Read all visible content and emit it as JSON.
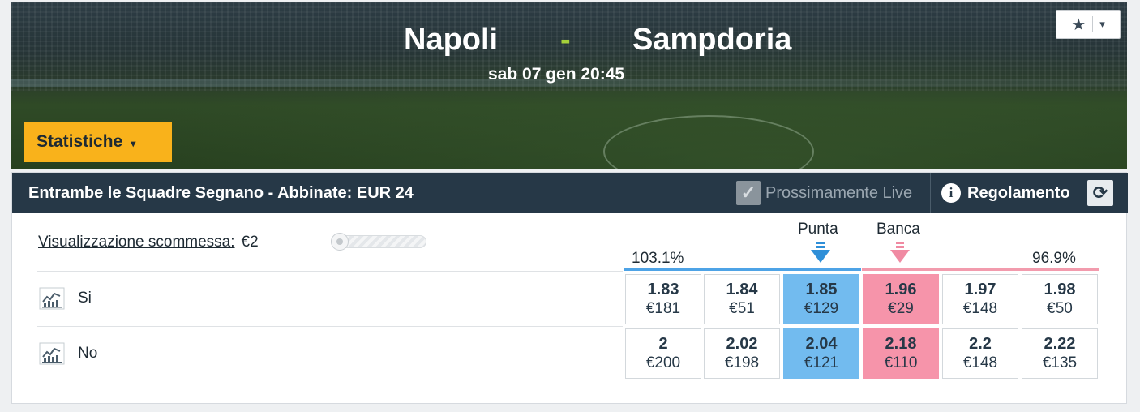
{
  "event": {
    "home_team": "Napoli",
    "separator": "-",
    "away_team": "Sampdoria",
    "datetime": "sab 07 gen 20:45"
  },
  "favourite": {
    "star": "★",
    "chevron": "▾"
  },
  "stats_button": {
    "label": "Statistiche",
    "caret": "▾"
  },
  "market": {
    "title": "Entrambe le Squadre Segnano - Abbinate: EUR 24",
    "live_label": "Prossimamente Live",
    "live_check": "✓",
    "rules_label": "Regolamento",
    "info_glyph": "i",
    "refresh_glyph": "⟳"
  },
  "stake": {
    "label": "Visualizzazione scommessa:",
    "value": "€2"
  },
  "columns": {
    "back_label": "Punta",
    "lay_label": "Banca",
    "back_pct": "103.1%",
    "lay_pct": "96.9%"
  },
  "colors": {
    "back_best": "#72bbef",
    "lay_best": "#f694aa",
    "header_bar": "#263847",
    "accent": "#f9b21b"
  },
  "runners": [
    {
      "name": "Si",
      "odds": [
        {
          "price": "1.83",
          "size": "€181"
        },
        {
          "price": "1.84",
          "size": "€51"
        },
        {
          "price": "1.85",
          "size": "€129"
        },
        {
          "price": "1.96",
          "size": "€29"
        },
        {
          "price": "1.97",
          "size": "€148"
        },
        {
          "price": "1.98",
          "size": "€50"
        }
      ]
    },
    {
      "name": "No",
      "odds": [
        {
          "price": "2",
          "size": "€200"
        },
        {
          "price": "2.02",
          "size": "€198"
        },
        {
          "price": "2.04",
          "size": "€121"
        },
        {
          "price": "2.18",
          "size": "€110"
        },
        {
          "price": "2.2",
          "size": "€148"
        },
        {
          "price": "2.22",
          "size": "€135"
        }
      ]
    }
  ]
}
